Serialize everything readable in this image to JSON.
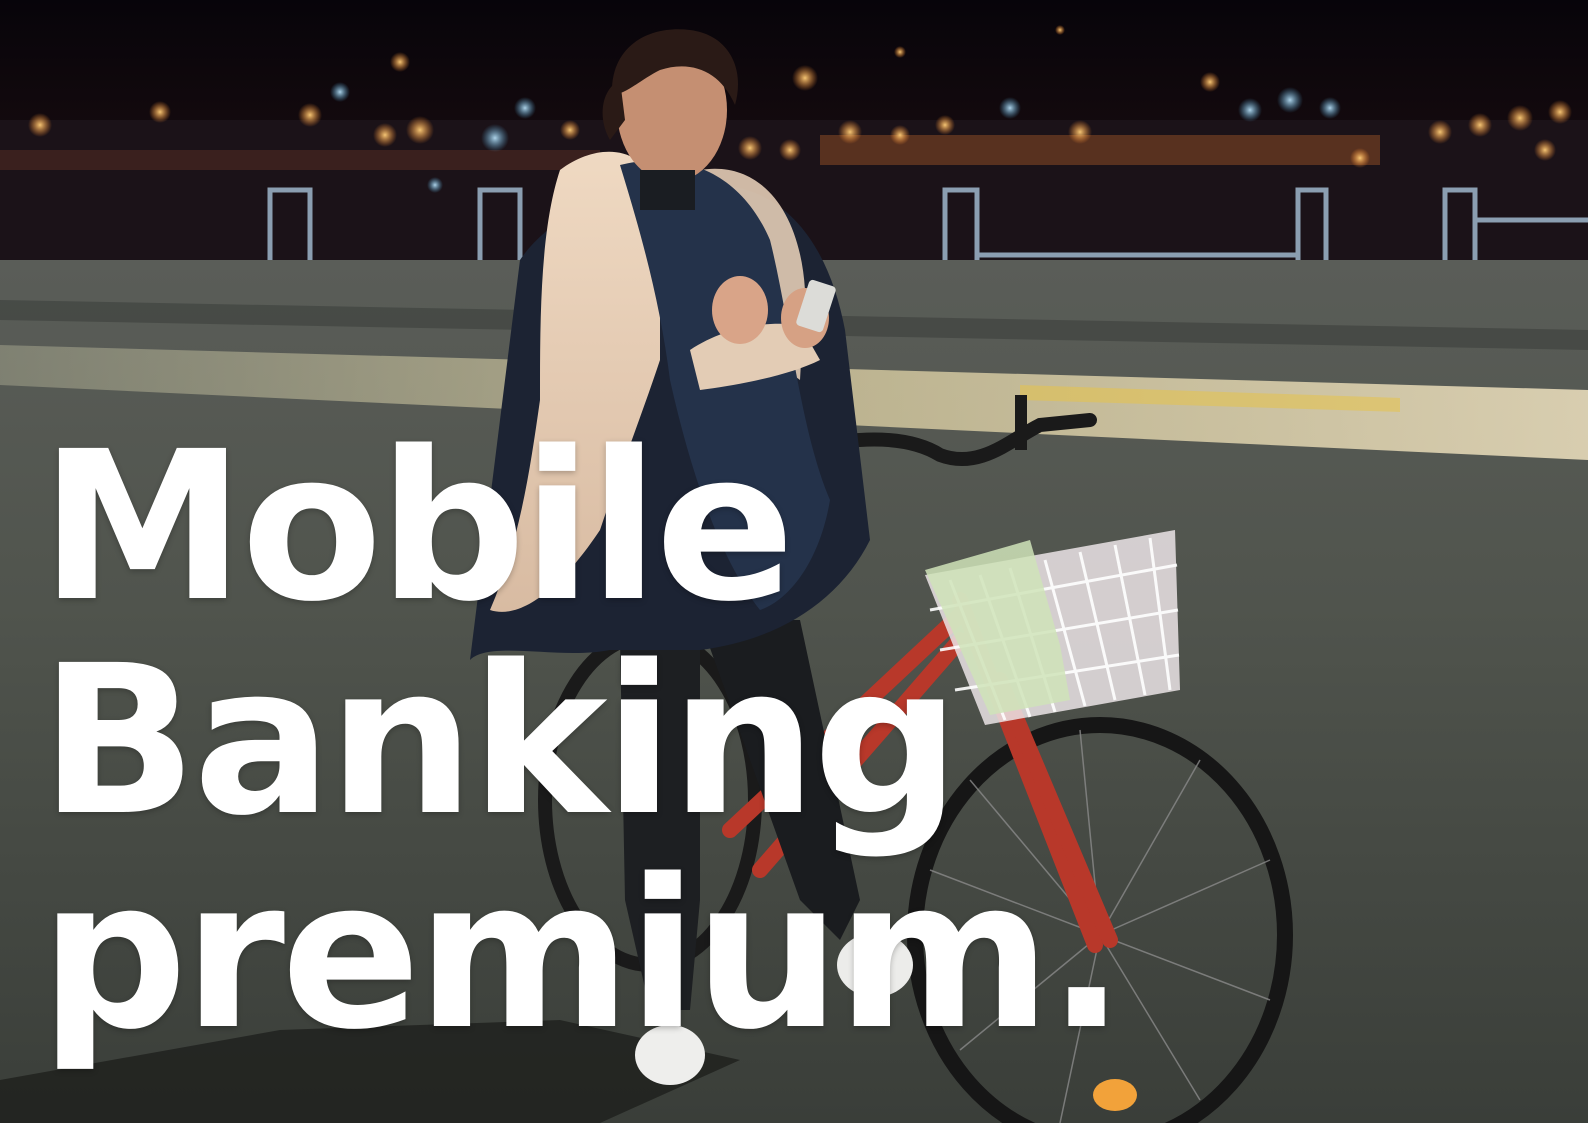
{
  "headline": {
    "line1": "Mobile",
    "line2": "Banking",
    "line3": "premium."
  },
  "colors": {
    "text": "#ffffff",
    "sky": "#0a0608",
    "asphalt": "#4a4e47",
    "bike_frame": "#b8382a",
    "scarf_light": "#e6cdb5",
    "scarf_dark": "#24324a",
    "city_lights": "#f0a040"
  },
  "photo": {
    "subject": "woman-with-bicycle-using-phone-at-night",
    "objects": [
      "city-lights-bokeh-icon",
      "bicycle-icon",
      "basket-icon",
      "smartphone-icon",
      "map-icon"
    ]
  }
}
